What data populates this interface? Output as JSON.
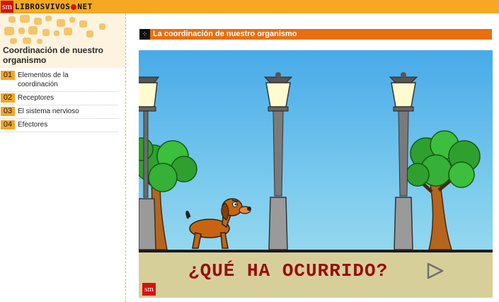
{
  "header": {
    "logo_badge": "sm",
    "logo_text_1": "LIBROSVIVOS",
    "logo_text_2": "NET",
    "bar_color": "#f7a823"
  },
  "sidebar": {
    "title": "Coordinación de nuestro organismo",
    "items": [
      {
        "num": "01",
        "label": "Elementos de la coordinación"
      },
      {
        "num": "02",
        "label": "Receptores"
      },
      {
        "num": "03",
        "label": "El sistema nervioso"
      },
      {
        "num": "04",
        "label": "Efectores"
      }
    ]
  },
  "section": {
    "title": "La coordinación de nuestro organismo",
    "color": "#e76f10"
  },
  "scene": {
    "question": "¿QUÉ HA OCURRIDO?",
    "next_icon": "play-triangle-icon",
    "badge": "sm",
    "question_color": "#9b0b0b"
  }
}
